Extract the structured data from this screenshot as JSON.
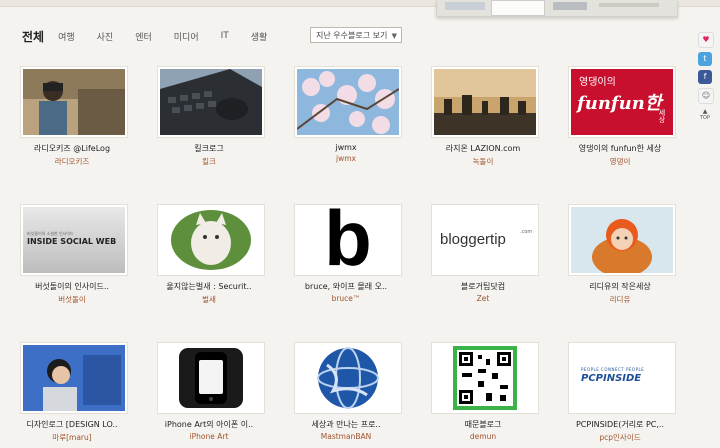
{
  "nav": {
    "all": "전체",
    "tabs": [
      "여행",
      "사진",
      "엔터",
      "미디어",
      "IT",
      "생활"
    ],
    "select_label": "지난 우수블로그 보기"
  },
  "cards": [
    {
      "title": "라디오키즈 @LifeLog",
      "author": "라디오키즈"
    },
    {
      "title": "킬크로그",
      "author": "킬크"
    },
    {
      "title": "jwmx",
      "author": "jwmx"
    },
    {
      "title": "라지온 LAZION.com",
      "author": "녹돌이"
    },
    {
      "title": "영댕이의 funfun한 세상",
      "author": "영댕이"
    },
    {
      "title": "버섯돌이의 인사이드..",
      "author": "버섯돌이"
    },
    {
      "title": "울지않는벌새 : Securit..",
      "author": "벌새"
    },
    {
      "title": "bruce, 와이프 몰래 오..",
      "author": "bruce™"
    },
    {
      "title": "블로거팁닷컴",
      "author": "Zet"
    },
    {
      "title": "리디유의 작은세상",
      "author": "리디유"
    },
    {
      "title": "디자인로그 [DESIGN LO..",
      "author": "마루[maru]"
    },
    {
      "title": "iPhone Art의 아이폰 이..",
      "author": "iPhone Art"
    },
    {
      "title": "세상과 만나는 프로..",
      "author": "MastmanBAN"
    },
    {
      "title": "때문블로그",
      "author": "demun"
    },
    {
      "title": "PCPINSIDE(거리로 PC,..",
      "author": "pcp인사이드"
    }
  ],
  "image_text": {
    "funfun_top": "영댕이의",
    "funfun_main": "funfun한",
    "funfun_side": "세상",
    "insider_small": "버섯돌이의 소설한 인사이드",
    "insider_main": "INSIDE SOCIAL WEB",
    "b_letter": "b",
    "bloggertip": "bloggertip",
    "bloggertip_com": ".com",
    "pcp_small": "PEOPLE CONNECT PEOPLE",
    "pcp_main": "PCPINSIDE"
  },
  "side": {
    "top_label": "TOP",
    "icons": [
      "blog-heart-icon",
      "twitter-icon",
      "facebook-icon",
      "me2day-icon"
    ]
  },
  "colors": {
    "author": "#a0522d",
    "background": "#f5f3ef",
    "funfun_bg": "#c8102e"
  }
}
